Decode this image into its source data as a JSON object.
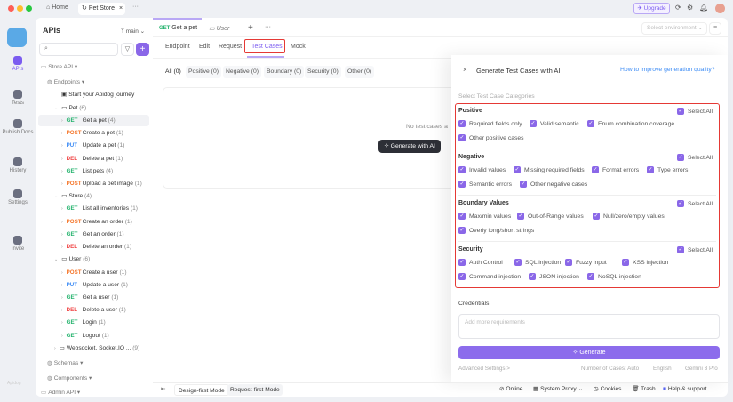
{
  "titlebar": {
    "tabs": [
      {
        "label": "Home",
        "icon": "home-icon"
      },
      {
        "label": "Pet Store",
        "icon": "refresh-icon"
      }
    ],
    "more": "···",
    "upgrade": "Upgrade"
  },
  "rail": [
    {
      "label": "APIs",
      "active": true
    },
    {
      "label": "Tests"
    },
    {
      "label": "Publish Docs"
    },
    {
      "label": "History"
    },
    {
      "label": "Settings"
    },
    {
      "label": "Invite"
    }
  ],
  "rail_logo": "Apidog",
  "sidebar": {
    "title": "APIs",
    "branch": "main",
    "tree": [
      {
        "t": "Store API ▾",
        "lvl": 0,
        "kind": "project"
      },
      {
        "t": "Endpoints ▾",
        "lvl": 1,
        "kind": "group"
      },
      {
        "t": "Start your Apidog journey",
        "lvl": 3,
        "kind": "doc"
      },
      {
        "t": "Pet",
        "c": "(6)",
        "lvl": 2,
        "kind": "folder"
      },
      {
        "m": "GET",
        "t": "Get a pet",
        "c": "(4)",
        "lvl": 3,
        "sel": true
      },
      {
        "m": "POST",
        "t": "Create a pet",
        "c": "(1)",
        "lvl": 3
      },
      {
        "m": "PUT",
        "t": "Update a pet",
        "c": "(1)",
        "lvl": 3
      },
      {
        "m": "DEL",
        "t": "Delete a pet",
        "c": "(1)",
        "lvl": 3
      },
      {
        "m": "GET",
        "t": "List pets",
        "c": "(4)",
        "lvl": 3
      },
      {
        "m": "POST",
        "t": "Upload a pet image",
        "c": "(1)",
        "lvl": 3
      },
      {
        "t": "Store",
        "c": "(4)",
        "lvl": 2,
        "kind": "folder"
      },
      {
        "m": "GET",
        "t": "List all inventories",
        "c": "(1)",
        "lvl": 3
      },
      {
        "m": "POST",
        "t": "Create an order",
        "c": "(1)",
        "lvl": 3
      },
      {
        "m": "GET",
        "t": "Get an order",
        "c": "(1)",
        "lvl": 3
      },
      {
        "m": "DEL",
        "t": "Delete an order",
        "c": "(1)",
        "lvl": 3
      },
      {
        "t": "User",
        "c": "(6)",
        "lvl": 2,
        "kind": "folder"
      },
      {
        "m": "POST",
        "t": "Create a user",
        "c": "(1)",
        "lvl": 3
      },
      {
        "m": "PUT",
        "t": "Update a user",
        "c": "(1)",
        "lvl": 3
      },
      {
        "m": "GET",
        "t": "Get a user",
        "c": "(1)",
        "lvl": 3
      },
      {
        "m": "DEL",
        "t": "Delete a user",
        "c": "(1)",
        "lvl": 3
      },
      {
        "m": "GET",
        "t": "Login",
        "c": "(1)",
        "lvl": 3
      },
      {
        "m": "GET",
        "t": "Logout",
        "c": "(1)",
        "lvl": 3
      },
      {
        "t": "Websocket, Socket.IO ...",
        "c": "(9)",
        "lvl": 2,
        "kind": "folder-closed"
      },
      {
        "t": "Schemas ▾",
        "lvl": 1,
        "kind": "group"
      },
      {
        "t": "Components ▾",
        "lvl": 1,
        "kind": "group"
      },
      {
        "t": "Admin API ▾",
        "lvl": 0,
        "kind": "project"
      }
    ]
  },
  "method_colors": {
    "GET": "#21b26b",
    "POST": "#f5762a",
    "PUT": "#3d8cf5",
    "DEL": "#f04545"
  },
  "main": {
    "tabs": [
      {
        "method": "GET",
        "label": "Get a pet"
      },
      {
        "label": "User"
      }
    ],
    "env_placeholder": "Select environment",
    "subtabs": [
      "Endpoint",
      "Edit",
      "Request",
      "Test Cases",
      "Mock"
    ],
    "filters": [
      "All (0)",
      "Positive (0)",
      "Negative (0)",
      "Boundary (0)",
      "Security (0)",
      "Other (0)"
    ],
    "empty": "No test cases a",
    "generate_ai": "Generate with AI"
  },
  "modal": {
    "title": "Generate Test Cases with AI",
    "help_link": "How to improve generation quality?",
    "subtitle": "Select Test Case Categories",
    "select_all": "Select All",
    "sections": [
      {
        "title": "Positive",
        "rows": [
          [
            "Required fields only",
            "Valid semantic",
            "Enum combination coverage"
          ],
          [
            "Other positive cases"
          ]
        ]
      },
      {
        "title": "Negative",
        "rows": [
          [
            "Invalid values",
            "Missing required fields",
            "Format errors",
            "Type errors"
          ],
          [
            "Semantic errors",
            "Other negative cases"
          ]
        ]
      },
      {
        "title": "Boundary Values",
        "rows": [
          [
            "Max/min values",
            "Out-of-Range values",
            "Null/zero/empty values"
          ],
          [
            "Overly long/short strings"
          ]
        ]
      },
      {
        "title": "Security",
        "rows": [
          [
            "Auth Control",
            "SQL injection",
            "Fuzzy input",
            "XSS injection"
          ],
          [
            "Command injection",
            "JSON injection",
            "NoSQL injection"
          ]
        ]
      }
    ],
    "credentials": "Credentials",
    "requirements_placeholder": "Add more requirements",
    "generate": "Generate",
    "advanced": "Advanced Settings >",
    "num_cases": "Number of Cases: Auto",
    "language": "English",
    "model": "Gemini 3 Pro"
  },
  "bottom": {
    "design_mode": "Design-first Mode",
    "request_mode": "Request-first Mode",
    "online": "Online",
    "proxy": "System Proxy",
    "cookies": "Cookies",
    "trash": "Trash",
    "help": "Help & support"
  },
  "colors": {
    "accent": "#8a67e8",
    "highlight": "#e53935"
  }
}
